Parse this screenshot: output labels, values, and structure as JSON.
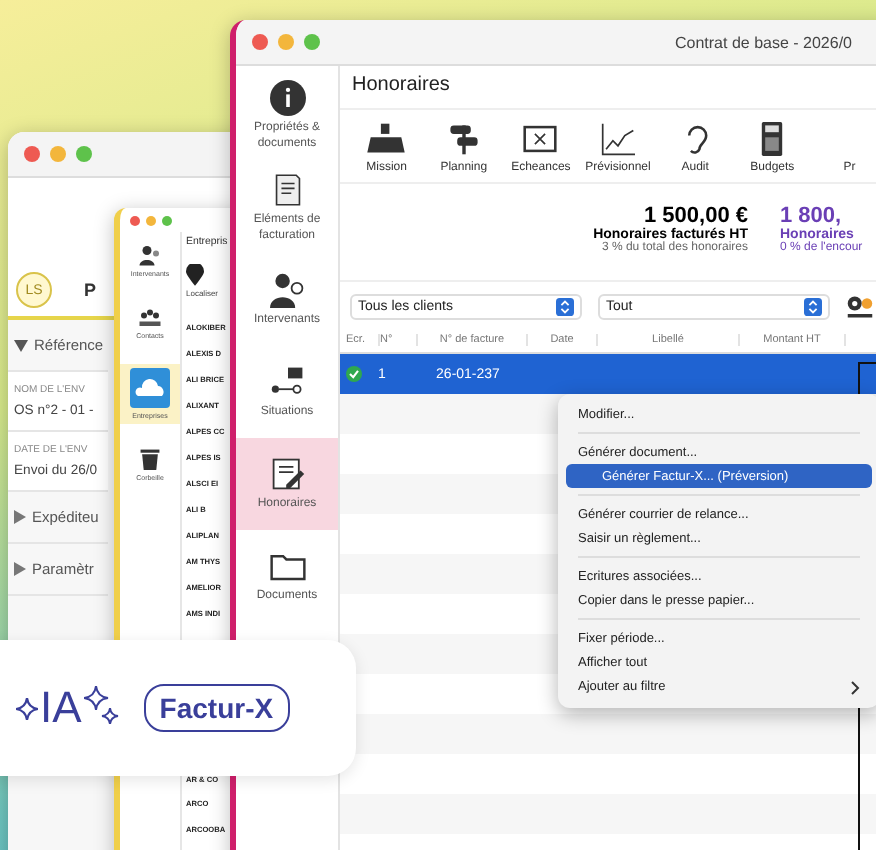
{
  "back_window": {
    "avatar": "LS",
    "tab": "P",
    "sections": [
      {
        "label": "Référence",
        "expanded": true,
        "fields": [
          {
            "label": "NOM DE L'ENV",
            "value": "OS n°2 - 01 -"
          },
          {
            "label": "DATE DE L'ENV",
            "value": "Envoi du 26/0"
          }
        ]
      },
      {
        "label": "Expéditeu",
        "expanded": false
      },
      {
        "label": "Paramètr",
        "expanded": false
      }
    ]
  },
  "middle_window": {
    "sidebar": [
      {
        "label": "Intervenants",
        "kind": "people",
        "selected": false
      },
      {
        "label": "Contacts",
        "kind": "contacts",
        "selected": false
      },
      {
        "label": "Entreprises",
        "kind": "cloud",
        "selected": true
      },
      {
        "label": "Corbeille",
        "kind": "trash",
        "selected": false
      }
    ],
    "title": "Entrepris",
    "tool": "Localiser",
    "names": [
      "ALOKIBER",
      "ALEXIS D",
      "ALI BRICE",
      "ALIXANT",
      "ALPES CC",
      "ALPES IS",
      "ALSCI EI",
      "ALI B",
      "ALIPLAN",
      "AM THYS",
      "AMELIOR",
      "AMS INDI"
    ],
    "names_below": [
      "AR & CO",
      "ARCO",
      "ARCOOBA"
    ]
  },
  "window": {
    "title": "Contrat de base - 2026/0"
  },
  "sidebar": {
    "items": [
      {
        "label": "Propriétés & documents",
        "kind": "info",
        "selected": false
      },
      {
        "label": "Eléments de facturation",
        "kind": "scroll",
        "selected": false
      },
      {
        "label": "Intervenants",
        "kind": "people",
        "selected": false
      },
      {
        "label": "Situations",
        "kind": "flow",
        "selected": false
      },
      {
        "label": "Honoraires",
        "kind": "edit",
        "selected": true
      },
      {
        "label": "Documents",
        "kind": "folder",
        "selected": false
      }
    ]
  },
  "header": "Honoraires",
  "toolbar": [
    {
      "label": "Mission",
      "kind": "register"
    },
    {
      "label": "Planning",
      "kind": "planning"
    },
    {
      "label": "Echeances",
      "kind": "calendar"
    },
    {
      "label": "Prévisionnel",
      "kind": "chart"
    },
    {
      "label": "Audit",
      "kind": "ear"
    },
    {
      "label": "Budgets",
      "kind": "calculator"
    },
    {
      "label": "Pr",
      "kind": "none"
    }
  ],
  "totals": [
    {
      "amount": "1 500,00 €",
      "label": "Honoraires facturés HT",
      "note": "3 % du total des honoraires",
      "kind": "plain"
    },
    {
      "amount": "1 800,",
      "label": "Honoraires",
      "note": "0 % de l'encour",
      "kind": "accent"
    }
  ],
  "filters": [
    {
      "value": "Tous les clients"
    },
    {
      "value": "Tout"
    }
  ],
  "table": {
    "columns": [
      "Ecr.",
      "N°",
      "N° de facture",
      "Date",
      "Libellé",
      "Montant HT"
    ],
    "rows": [
      {
        "checked": true,
        "number": "1",
        "invoice": "26-01-237",
        "selected": true
      }
    ]
  },
  "context_menu": {
    "groups": [
      [
        {
          "label": "Modifier...",
          "selected": false,
          "submenu": false
        }
      ],
      [
        {
          "label": "Générer document...",
          "selected": false,
          "submenu": false
        },
        {
          "label": "Générer Factur-X... (Préversion)",
          "selected": true,
          "submenu": false
        }
      ],
      [
        {
          "label": "Générer courrier de relance...",
          "selected": false,
          "submenu": false
        },
        {
          "label": "Saisir un règlement...",
          "selected": false,
          "submenu": false
        }
      ],
      [
        {
          "label": "Ecritures associées...",
          "selected": false,
          "submenu": false
        },
        {
          "label": "Copier dans le presse papier...",
          "selected": false,
          "submenu": false
        }
      ],
      [
        {
          "label": "Fixer période...",
          "selected": false,
          "submenu": false
        },
        {
          "label": "Afficher tout",
          "selected": false,
          "submenu": false
        },
        {
          "label": "Ajouter au filtre",
          "selected": false,
          "submenu": true
        }
      ]
    ]
  },
  "badge": {
    "ai": "IA",
    "tag": "Factur-X"
  }
}
